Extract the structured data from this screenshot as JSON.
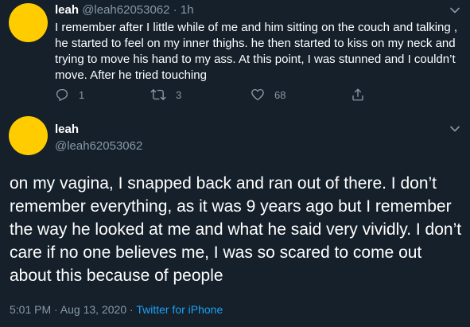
{
  "tweet1": {
    "display_name": "leah",
    "handle": "@leah62053062",
    "separator": " · ",
    "time": "1h",
    "text": "I remember after I little while of me and him sitting on the couch and talking , he started to feel on my inner thighs. he then started to kiss on my neck and trying to move his hand to my ass. At this point, I was stunned and I couldn’t move. After he tried touching",
    "reply_count": "1",
    "retweet_count": "3",
    "like_count": "68",
    "icons": {
      "reply": "reply-icon",
      "retweet": "retweet-icon",
      "like": "heart-icon",
      "share": "share-icon",
      "menu": "chevron-down-icon"
    }
  },
  "tweet2": {
    "display_name": "leah",
    "handle": "@leah62053062",
    "text": "on my vagina, I snapped back and ran out of there. I don’t remember everything, as it was 9 years ago but I remember the way he looked at me and what he said very vividly. I don’t care if no one believes me, I was so scared to come out about this because of people",
    "timestamp": "5:01 PM · Aug 13, 2020",
    "meta_separator": " · ",
    "source": "Twitter for iPhone",
    "icons": {
      "menu": "chevron-down-icon"
    }
  },
  "colors": {
    "background": "#15202b",
    "text": "#ffffff",
    "muted": "#8899a6",
    "link": "#1da1f2",
    "avatar": "#ffcc00"
  }
}
